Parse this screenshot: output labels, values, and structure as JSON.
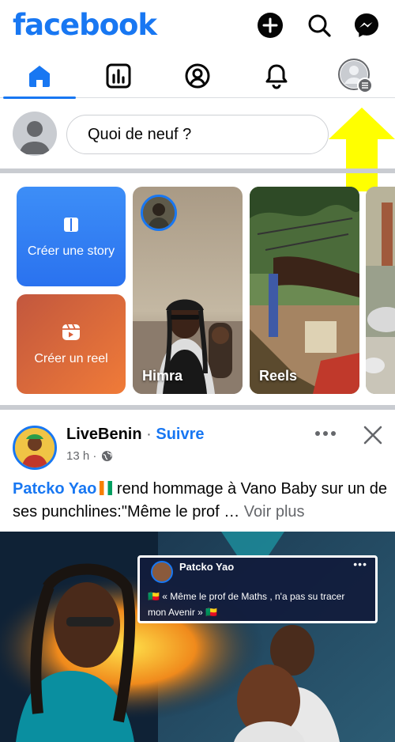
{
  "header": {
    "logo": "facebook",
    "icons": [
      "plus-icon",
      "search-icon",
      "messenger-icon"
    ]
  },
  "nav": {
    "items": [
      {
        "name": "home",
        "icon": "home-icon",
        "active": true
      },
      {
        "name": "dashboard",
        "icon": "chart-icon",
        "active": false
      },
      {
        "name": "profile",
        "icon": "user-circle-icon",
        "active": false
      },
      {
        "name": "notifications",
        "icon": "bell-icon",
        "active": false
      },
      {
        "name": "menu",
        "icon": "avatar-menu-icon",
        "active": false
      }
    ]
  },
  "composer": {
    "placeholder": "Quoi de neuf ?"
  },
  "stories": {
    "create_story": "Créer une story",
    "create_reel": "Créer un reel",
    "items": [
      {
        "name": "Himra"
      },
      {
        "name": "Reels"
      }
    ]
  },
  "post": {
    "author": "LiveBenin",
    "separator": "·",
    "follow": "Suivre",
    "time": "13 h ·",
    "mention": "Patcko Yao",
    "text": " rend hommage à Vano Baby sur un de ses punchlines:\"Même le prof … ",
    "see_more": "Voir plus",
    "image": {
      "quote_name": "Patcko Yao",
      "quote_line1": "🇧🇯 « Même le prof de Maths , n'a pas su tracer",
      "quote_line2": "mon Avenir » 🇧🇯",
      "quote_dots": "•••"
    }
  },
  "colors": {
    "brand": "#1877f2",
    "arrow": "#ffff00",
    "create_story_card": "#3b82f6",
    "create_reel_card": "#e0653d"
  }
}
